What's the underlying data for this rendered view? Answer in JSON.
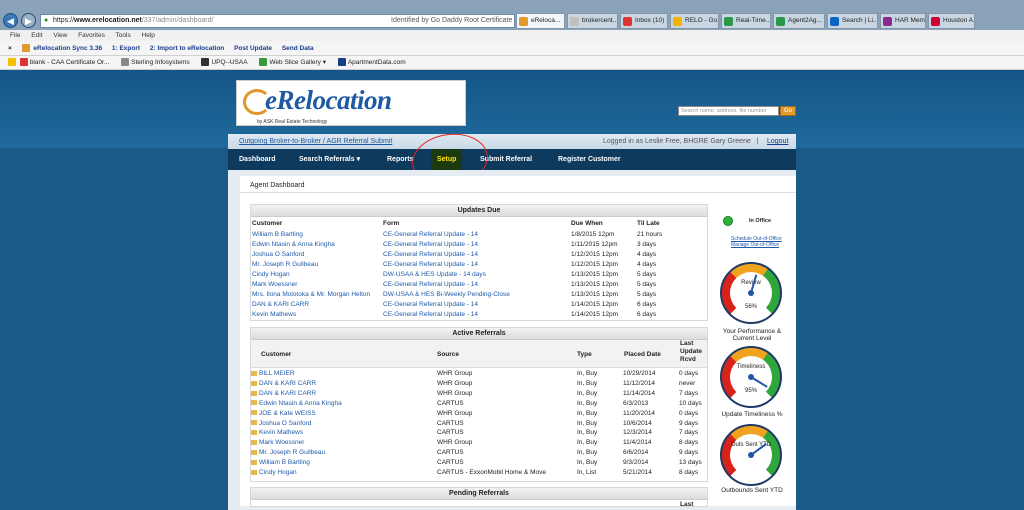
{
  "browser": {
    "url_prefix": "https://",
    "url_host": "www.erelocation.net",
    "url_path": "/337/admin/dashboard/",
    "cert": "Identified by Go Daddy Root Certificate Autho...",
    "tabs": [
      {
        "label": "eReloca...",
        "color": "#e29a2b"
      },
      {
        "label": "brokercent...",
        "color": "#c0c0c0"
      },
      {
        "label": "Inbox (10) ...",
        "color": "#d33"
      },
      {
        "label": "RELO - Go...",
        "color": "#f2b300"
      },
      {
        "label": "Real-Time...",
        "color": "#2a9a4a"
      },
      {
        "label": "Agent2Ag...",
        "color": "#2a9a4a"
      },
      {
        "label": "Search | Li...",
        "color": "#0a66c2"
      },
      {
        "label": "HAR Mem...",
        "color": "#8a2a8a"
      },
      {
        "label": "Houston A...",
        "color": "#c03"
      }
    ],
    "menu": [
      "File",
      "Edit",
      "View",
      "Favorites",
      "Tools",
      "Help"
    ],
    "toolbar": [
      "eRelocation Sync 3.36",
      "1: Export",
      "2: Import to eRelocation",
      "Post Update",
      "Send Data"
    ],
    "favorites": [
      "blank - CAA Certificate Or...",
      "Sterling Infosystems",
      "UPQ--USAA",
      "Web Slice Gallery ▾",
      "ApartmentData.com"
    ]
  },
  "header": {
    "brand": "eRelocation",
    "byline": "by ASK Real Estate Technology",
    "search_placeholder": "Search name, address, file number",
    "search_button": "Go"
  },
  "subbar": {
    "link": "Outgoing Broker-to-Broker / AGR Referral Submit",
    "who": "Logged in as Leslie Free, BHGRE Gary Greene",
    "sep": "|",
    "logout": "Logout"
  },
  "nav": [
    "Dashboard",
    "Search Referrals ▾",
    "Reports",
    "Setup",
    "Submit Referral",
    "Register Customer"
  ],
  "page_title": "Agent Dashboard",
  "updates": {
    "title": "Updates Due",
    "headers": [
      "Customer",
      "Form",
      "Due When",
      "Til Late"
    ],
    "rows": [
      [
        "William B Bartling",
        "CE-General Referral Update - 14",
        "1/8/2015 12pm",
        "21 hours"
      ],
      [
        "Edwin Ntasin & Anna Kingha",
        "CE-General Referral Update - 14",
        "1/11/2015 12pm",
        "3 days"
      ],
      [
        "Joshua O Sanford",
        "CE-General Referral Update - 14",
        "1/12/2015 12pm",
        "4 days"
      ],
      [
        "Mr. Joseph R Guilbeau",
        "CE-General Referral Update - 14",
        "1/12/2015 12pm",
        "4 days"
      ],
      [
        "Cindy Hogan",
        "DW-USAA & HES Update - 14 days",
        "1/13/2015 12pm",
        "5 days"
      ],
      [
        "Mark Woessner",
        "CE-General Referral Update - 14",
        "1/13/2015 12pm",
        "5 days"
      ],
      [
        "Mrs. Ilona Molotoka & Mr. Morgan Helton",
        "DW-USAA & HES Bi-Weekly Pending-Close",
        "1/13/2015 12pm",
        "5 days"
      ],
      [
        "DAN & KARI CARR",
        "CE-General Referral Update - 14",
        "1/14/2015 12pm",
        "6 days"
      ],
      [
        "Kevin Mathews",
        "CE-General Referral Update - 14",
        "1/14/2015 12pm",
        "6 days"
      ]
    ]
  },
  "active": {
    "title": "Active Referrals",
    "headers": [
      "Customer",
      "Source",
      "Type",
      "Placed Date",
      "Last Update Rcvd"
    ],
    "header_last_lines": [
      "Last",
      "Update",
      "Rcvd"
    ],
    "rows": [
      [
        "BILL MEIER",
        "WHR Group",
        "In, Buy",
        "10/29/2014",
        "0 days"
      ],
      [
        "DAN & KARI CARR",
        "WHR Group",
        "In, Buy",
        "11/12/2014",
        "never"
      ],
      [
        "DAN & KARI CARR",
        "WHR Group",
        "In, Buy",
        "11/14/2014",
        "7 days"
      ],
      [
        "Edwin Ntasin & Anna Kingha",
        "CARTUS",
        "In, Buy",
        "6/3/2013",
        "10 days"
      ],
      [
        "JOE & Kate WEISS",
        "WHR Group",
        "In, Buy",
        "11/20/2014",
        "0 days"
      ],
      [
        "Joshua O Sanford",
        "CARTUS",
        "In, Buy",
        "10/6/2014",
        "9 days"
      ],
      [
        "Kevin Mathews",
        "CARTUS",
        "In, Buy",
        "12/3/2014",
        "7 days"
      ],
      [
        "Mark Woessner",
        "WHR Group",
        "In, Buy",
        "11/4/2014",
        "8 days"
      ],
      [
        "Mr. Joseph R Guilbeau",
        "CARTUS",
        "In, Buy",
        "6/6/2014",
        "9 days"
      ],
      [
        "William B Bartling",
        "CARTUS",
        "In, Buy",
        "9/3/2014",
        "13 days"
      ],
      [
        "Cindy Hogan",
        "CARTUS - ExxonMobil Home & Move",
        "In, List",
        "5/21/2014",
        "8 days"
      ]
    ]
  },
  "pending": {
    "title": "Pending Referrals",
    "header_last": "Last"
  },
  "sidebar": {
    "status": "In Office",
    "schedule": "Schedule Out-of-Office",
    "manage": "Manage Out-of-Office",
    "gauges": [
      {
        "label": "Review",
        "pct": "56%",
        "value": 0.56,
        "caption": "Your Performance & Current Level"
      },
      {
        "label": "Timeliness",
        "pct": "95%",
        "value": 0.95,
        "caption": "Update Timeliness %"
      },
      {
        "label": "Outs Sent YTD",
        "pct": "",
        "value": 0.7,
        "caption": "Outbounds Sent YTD"
      }
    ]
  }
}
